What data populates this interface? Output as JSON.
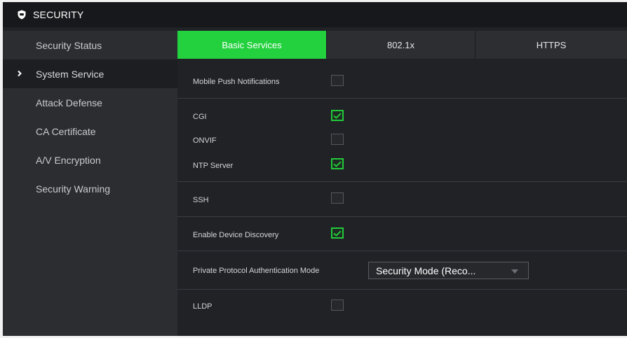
{
  "header": {
    "title": "SECURITY",
    "icon": "shield-icon"
  },
  "sidebar": {
    "items": [
      {
        "label": "Security Status",
        "active": false
      },
      {
        "label": "System Service",
        "active": true
      },
      {
        "label": "Attack Defense",
        "active": false
      },
      {
        "label": "CA Certificate",
        "active": false
      },
      {
        "label": "A/V Encryption",
        "active": false
      },
      {
        "label": "Security Warning",
        "active": false
      }
    ]
  },
  "tabs": [
    {
      "label": "Basic Services",
      "active": true
    },
    {
      "label": "802.1x",
      "active": false
    },
    {
      "label": "HTTPS",
      "active": false
    }
  ],
  "settings": {
    "mobile_push": {
      "label": "Mobile Push Notifications",
      "checked": false
    },
    "cgi": {
      "label": "CGI",
      "checked": true
    },
    "onvif": {
      "label": "ONVIF",
      "checked": false
    },
    "ntp": {
      "label": "NTP Server",
      "checked": true
    },
    "ssh": {
      "label": "SSH",
      "checked": false
    },
    "device_discovery": {
      "label": "Enable Device Discovery",
      "checked": true
    },
    "auth_mode": {
      "label": "Private Protocol Authentication Mode",
      "value": "Security Mode (Reco..."
    },
    "lldp": {
      "label": "LLDP",
      "checked": false
    }
  },
  "colors": {
    "accent": "#23d13e",
    "check": "#22c93a",
    "background": "#202226",
    "sidebar": "#2b2d31",
    "topbar": "#17181b"
  }
}
